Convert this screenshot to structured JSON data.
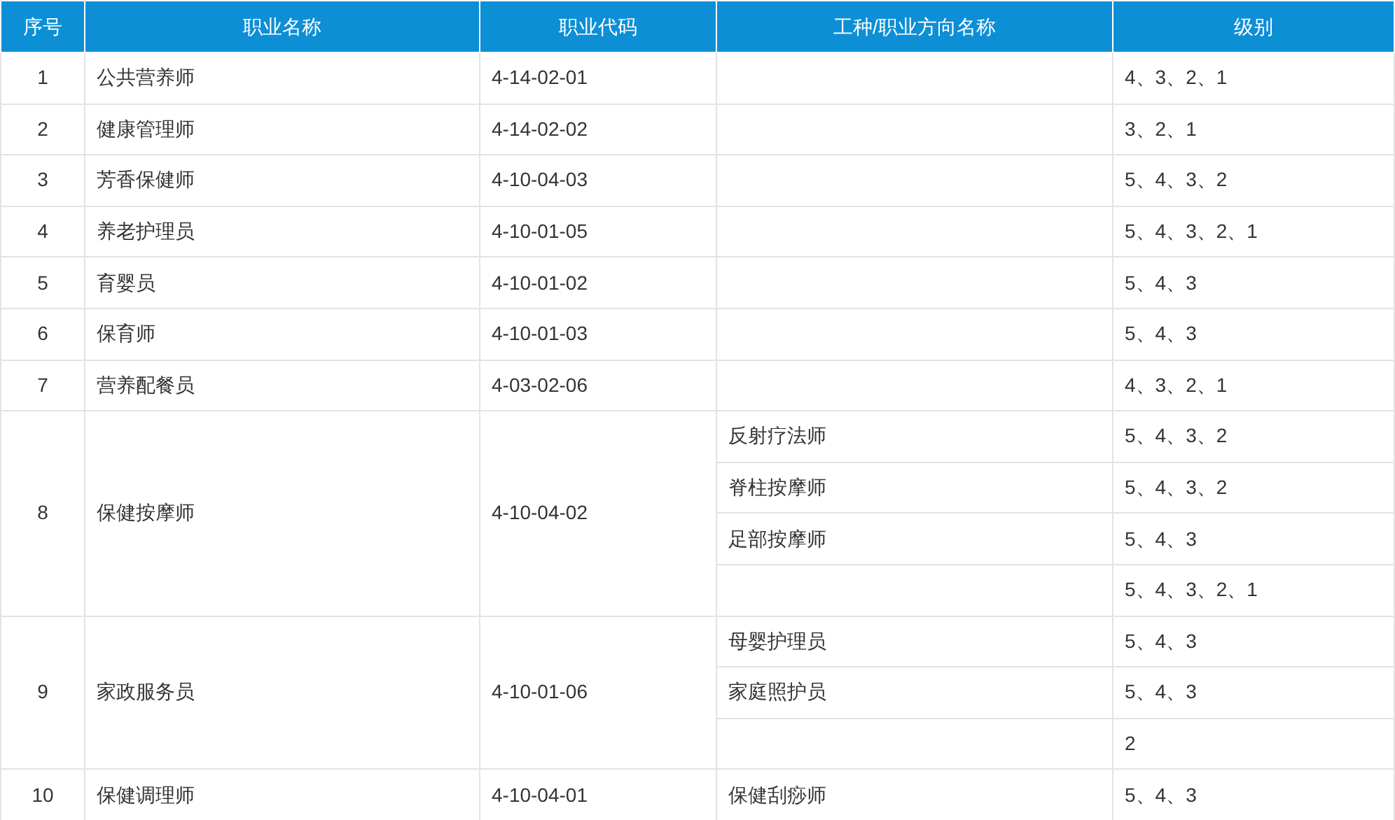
{
  "table": {
    "columns": [
      "序号",
      "职业名称",
      "职业代码",
      "工种/职业方向名称",
      "级别"
    ],
    "rows": [
      {
        "seq": "1",
        "name": "公共营养师",
        "code": "4-14-02-01",
        "directions": [
          {
            "level": "4、3、2、1"
          }
        ]
      },
      {
        "seq": "2",
        "name": "健康管理师",
        "code": "4-14-02-02",
        "directions": [
          {
            "level": "3、2、1"
          }
        ]
      },
      {
        "seq": "3",
        "name": "芳香保健师",
        "code": "4-10-04-03",
        "directions": [
          {
            "level": "5、4、3、2"
          }
        ]
      },
      {
        "seq": "4",
        "name": "养老护理员",
        "code": "4-10-01-05",
        "directions": [
          {
            "level": "5、4、3、2、1"
          }
        ]
      },
      {
        "seq": "5",
        "name": "育婴员",
        "code": "4-10-01-02",
        "directions": [
          {
            "level": "5、4、3"
          }
        ]
      },
      {
        "seq": "6",
        "name": "保育师",
        "code": "4-10-01-03",
        "directions": [
          {
            "level": "5、4、3"
          }
        ]
      },
      {
        "seq": "7",
        "name": "营养配餐员",
        "code": "4-03-02-06",
        "directions": [
          {
            "level": "4、3、2、1"
          }
        ]
      },
      {
        "seq": "8",
        "name": "保健按摩师",
        "code": "4-10-04-02",
        "directions": [
          {
            "name": "反射疗法师",
            "level": "5、4、3、2"
          },
          {
            "name": "脊柱按摩师",
            "level": "5、4、3、2"
          },
          {
            "name": "足部按摩师",
            "level": "5、4、3"
          },
          {
            "level": "5、4、3、2、1"
          }
        ]
      },
      {
        "seq": "9",
        "name": "家政服务员",
        "code": "4-10-01-06",
        "directions": [
          {
            "name": "母婴护理员",
            "level": "5、4、3"
          },
          {
            "name": "家庭照护员",
            "level": "5、4、3"
          },
          {
            "level": "2"
          }
        ]
      },
      {
        "seq": "10",
        "name": "保健调理师",
        "code": "4-10-04-01",
        "directions": [
          {
            "name": "保健刮痧师",
            "level": "5、4、3"
          }
        ]
      }
    ]
  }
}
